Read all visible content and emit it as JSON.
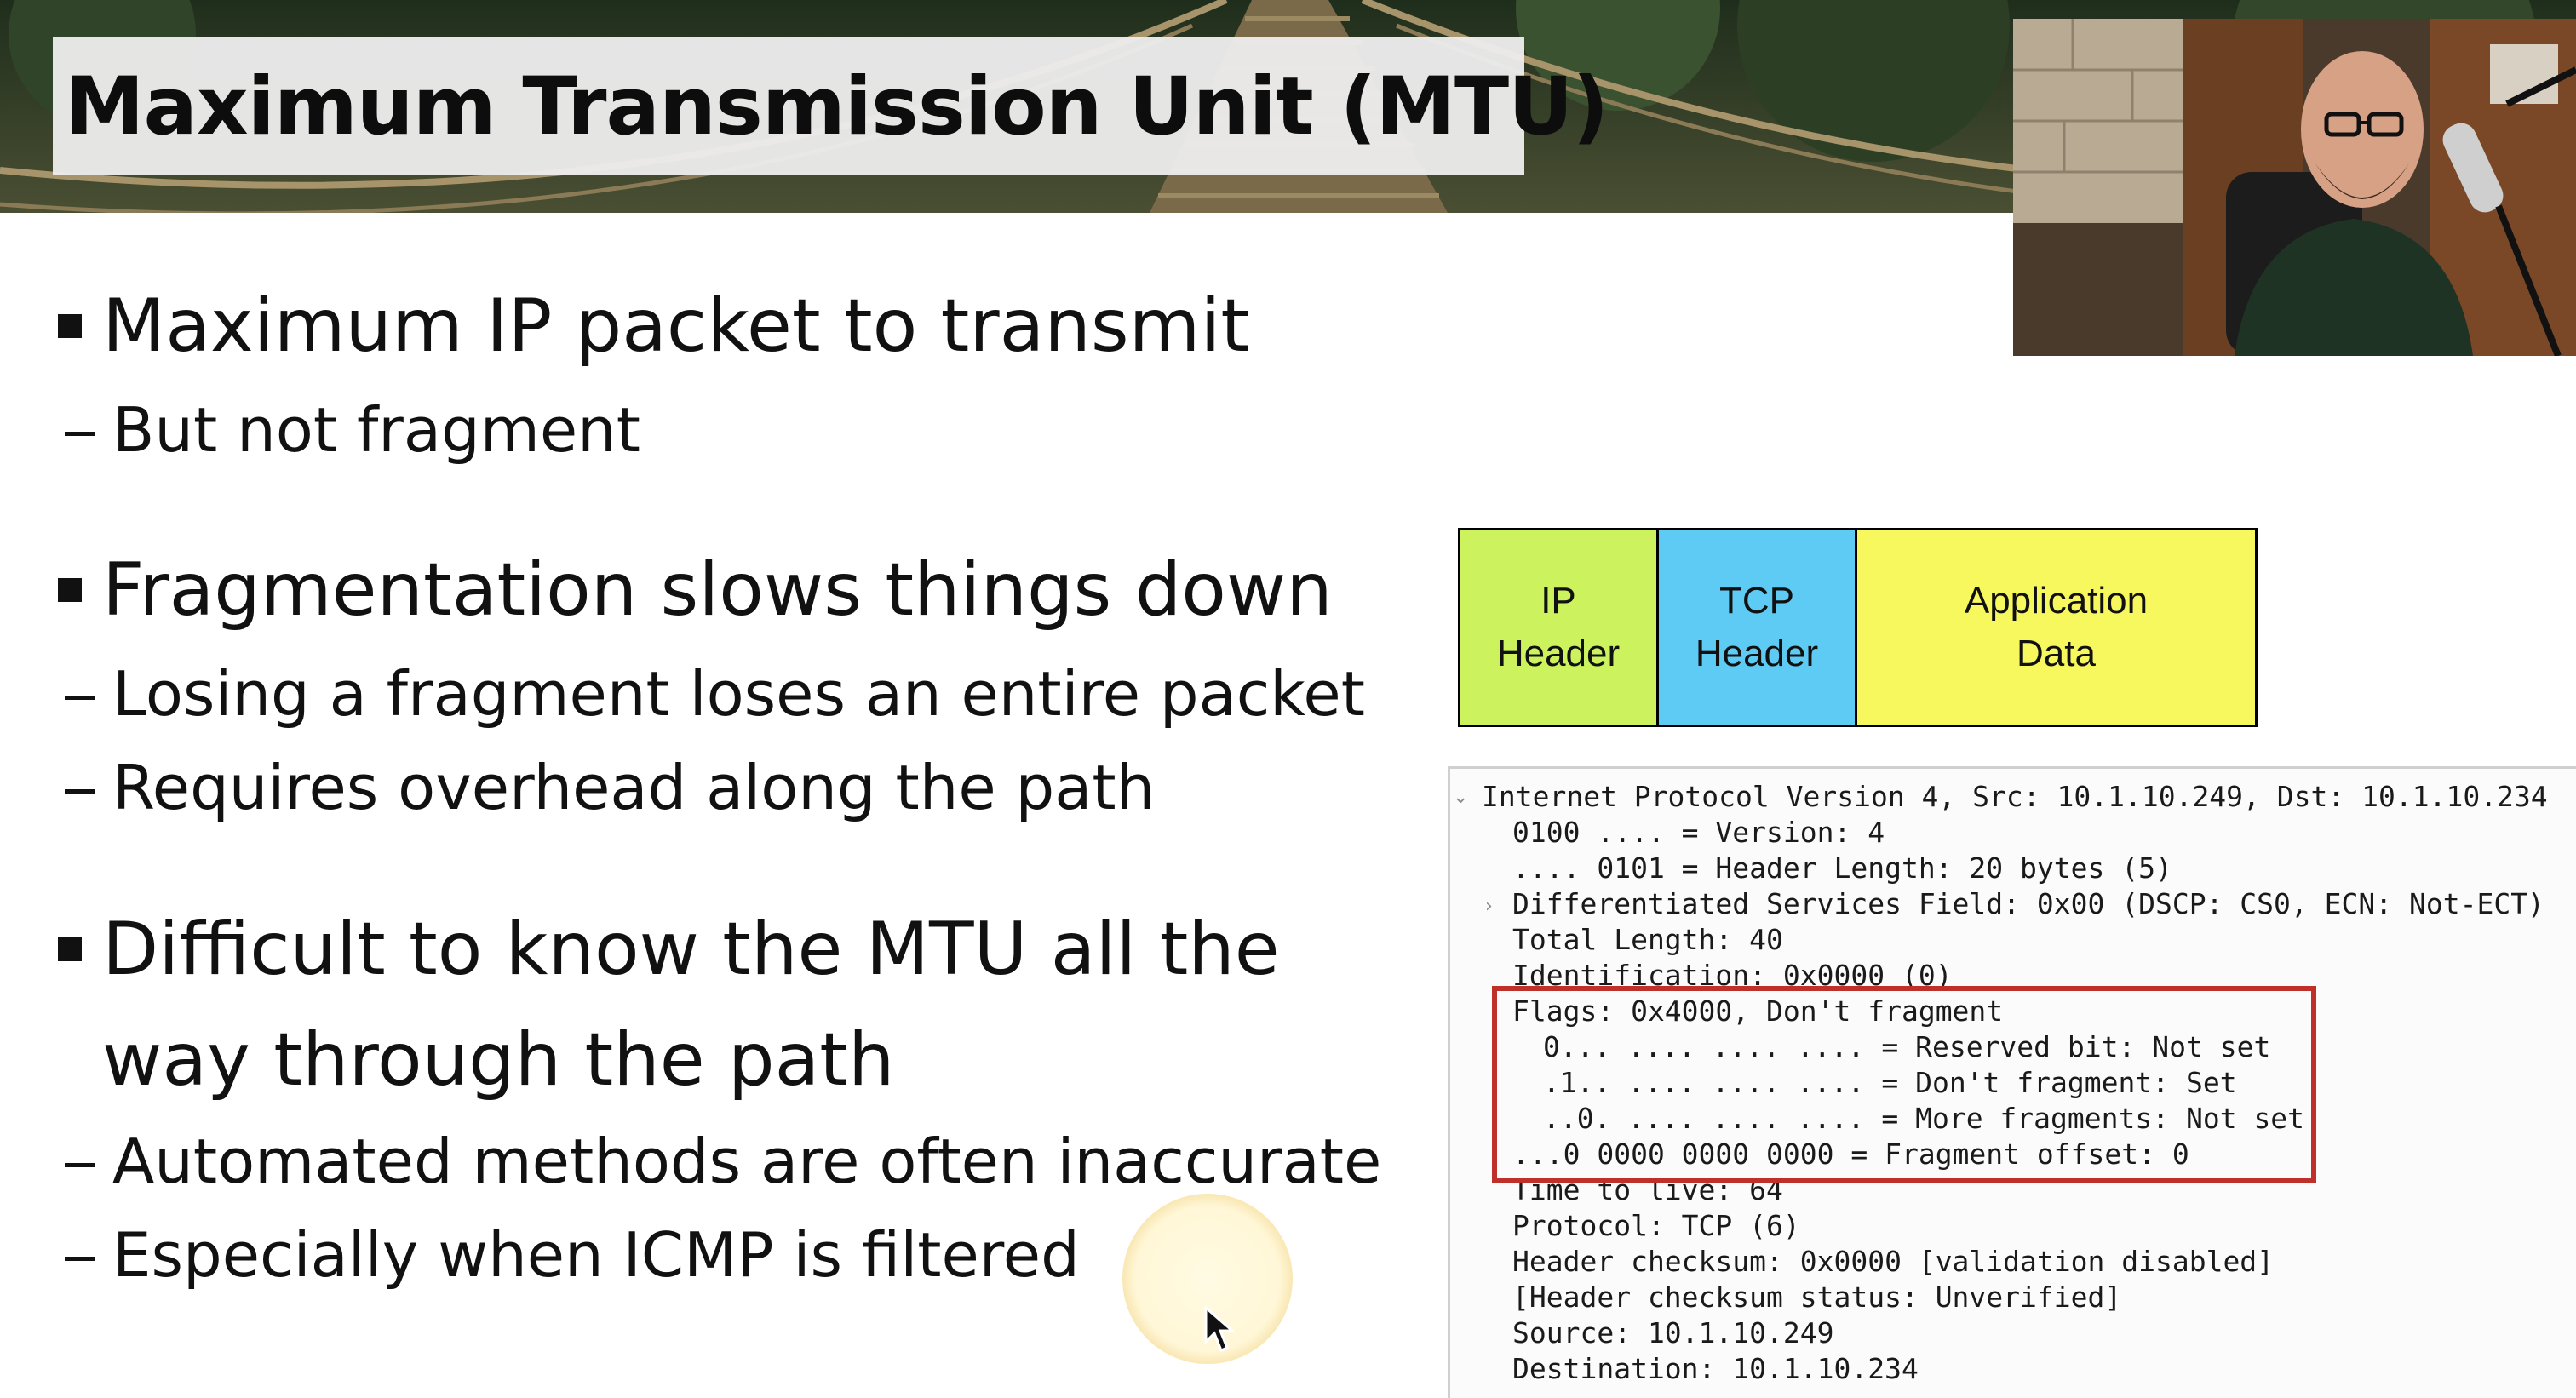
{
  "slide": {
    "title": "Maximum Transmission Unit (MTU)"
  },
  "bullets": [
    {
      "text": "Maximum IP packet to transmit",
      "subs": [
        "But not fragment"
      ]
    },
    {
      "text": "Fragmentation slows things down",
      "subs": [
        "Losing a fragment loses an entire packet",
        "Requires overhead along the path"
      ]
    },
    {
      "text_line1": "Difficult to know the MTU all the",
      "text_line2": "way through the path",
      "subs": [
        "Automated methods are often inaccurate",
        "Especially when ICMP is filtered"
      ]
    }
  ],
  "packet": {
    "segments": [
      {
        "line1": "IP",
        "line2": "Header",
        "color": "#ccf25e"
      },
      {
        "line1": "TCP",
        "line2": "Header",
        "color": "#5ecbf5"
      },
      {
        "line1": "Application",
        "line2": "Data",
        "color": "#f7f75e"
      }
    ]
  },
  "wireshark": {
    "lines": [
      "Internet Protocol Version 4, Src: 10.1.10.249, Dst: 10.1.10.234",
      "0100 .... = Version: 4",
      ".... 0101 = Header Length: 20 bytes (5)",
      "Differentiated Services Field: 0x00 (DSCP: CS0, ECN: Not-ECT)",
      "Total Length: 40",
      "Identification: 0x0000 (0)",
      "Flags: 0x4000, Don't fragment",
      "0... .... .... .... = Reserved bit: Not set",
      ".1.. .... .... .... = Don't fragment: Set",
      "..0. .... .... .... = More fragments: Not set",
      "...0 0000 0000 0000 = Fragment offset: 0",
      "Time to live: 64",
      "Protocol: TCP (6)",
      "Header checksum: 0x0000 [validation disabled]",
      "[Header checksum status: Unverified]",
      "Source: 10.1.10.249",
      "Destination: 10.1.10.234"
    ],
    "expanded_icon": "chevron-down-icon",
    "collapsed_icon": "chevron-right-icon",
    "highlight_color": "#c0302b"
  },
  "webcam": {
    "icon": "presenter-video"
  }
}
